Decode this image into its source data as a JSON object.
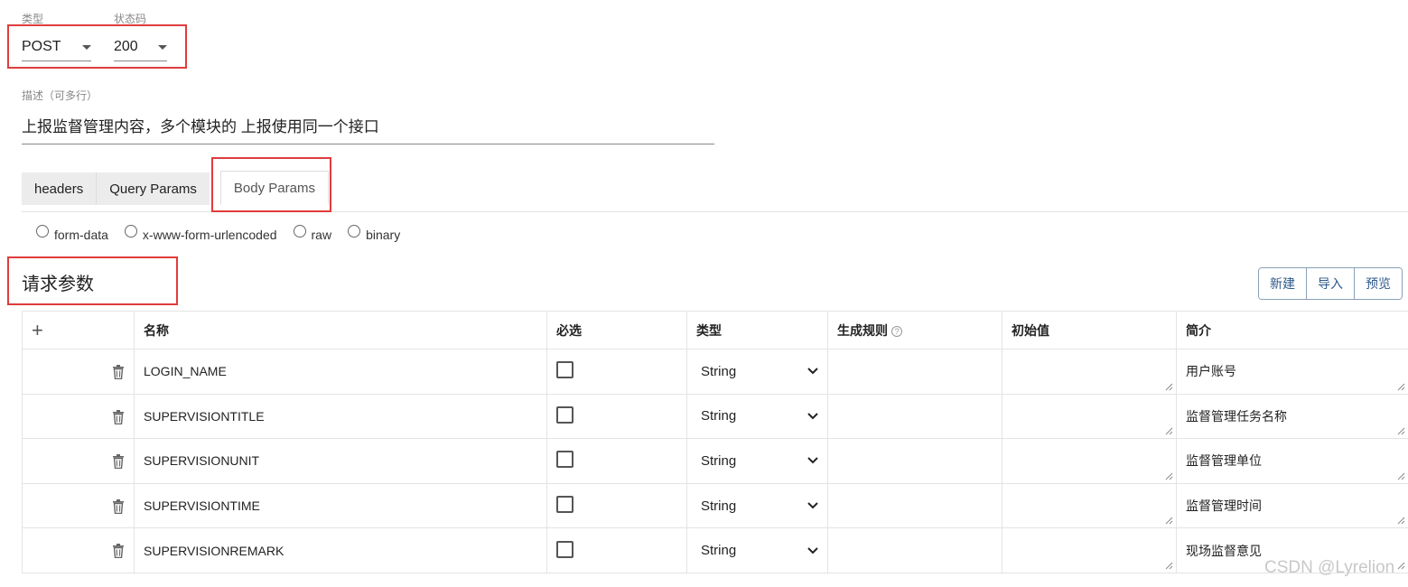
{
  "request": {
    "type_label": "类型",
    "type_value": "POST",
    "status_label": "状态码",
    "status_value": "200",
    "description_label": "描述（可多行）",
    "description_value": "上报监督管理内容，多个模块的 上报使用同一个接口"
  },
  "tabs": [
    {
      "label": "headers",
      "active": false
    },
    {
      "label": "Query Params",
      "active": false
    },
    {
      "label": "Body Params",
      "active": true
    }
  ],
  "body_types": [
    "form-data",
    "x-www-form-urlencoded",
    "raw",
    "binary"
  ],
  "section": {
    "title": "请求参数",
    "buttons": [
      "新建",
      "导入",
      "预览"
    ]
  },
  "table": {
    "add_symbol": "+",
    "headers": {
      "name": "名称",
      "required": "必选",
      "type": "类型",
      "rule": "生成规则",
      "rule_help": "?",
      "initial": "初始值",
      "intro": "简介"
    },
    "rows": [
      {
        "name": "LOGIN_NAME",
        "type": "String",
        "intro": "用户账号"
      },
      {
        "name": "SUPERVISIONTITLE",
        "type": "String",
        "intro": "监督管理任务名称"
      },
      {
        "name": "SUPERVISIONUNIT",
        "type": "String",
        "intro": "监督管理单位"
      },
      {
        "name": "SUPERVISIONTIME",
        "type": "String",
        "intro": "监督管理时间"
      },
      {
        "name": "SUPERVISIONREMARK",
        "type": "String",
        "intro": "现场监督意见"
      }
    ]
  },
  "watermark": "CSDN @Lyrelion",
  "colors": {
    "highlight": "#e03c3c",
    "button_text": "#2d5a8a"
  }
}
